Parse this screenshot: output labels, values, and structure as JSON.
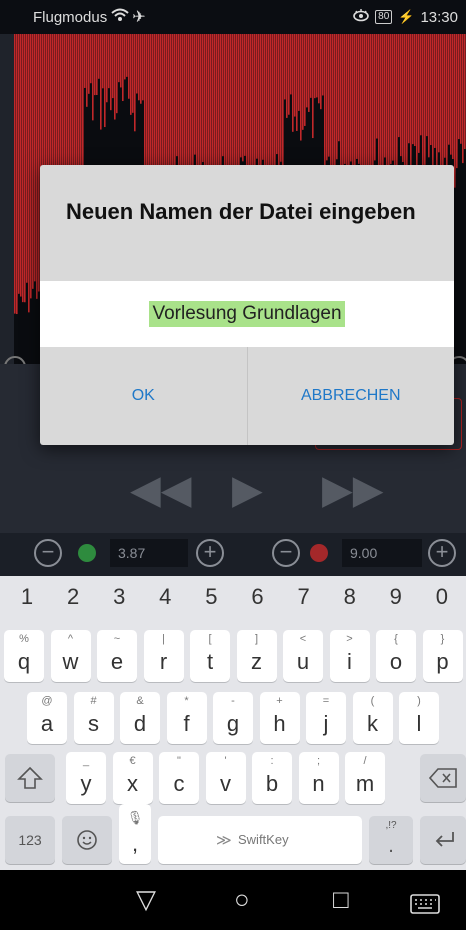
{
  "status_bar": {
    "left_text": "Flugmodus",
    "wifi_icon": "wifi-icon",
    "airplane_icon": "airplane-icon",
    "battery": "80",
    "time": "13:30"
  },
  "editor": {
    "start_value": "3.87",
    "end_value": "9.00",
    "waveform_color": "#c0282a"
  },
  "dialog": {
    "title": "Neuen Namen der Datei eingeben",
    "input_value": "Vorlesung Grundlagen",
    "ok_label": "OK",
    "cancel_label": "ABBRECHEN",
    "button_color": "#1f78c8",
    "selection_color": "#a9e28a"
  },
  "keyboard": {
    "number_row": [
      "1",
      "2",
      "3",
      "4",
      "5",
      "6",
      "7",
      "8",
      "9",
      "0"
    ],
    "row1": [
      {
        "main": "q",
        "sub": "%"
      },
      {
        "main": "w",
        "sub": "^"
      },
      {
        "main": "e",
        "sub": "~"
      },
      {
        "main": "r",
        "sub": "|"
      },
      {
        "main": "t",
        "sub": "["
      },
      {
        "main": "z",
        "sub": "]"
      },
      {
        "main": "u",
        "sub": "<"
      },
      {
        "main": "i",
        "sub": ">"
      },
      {
        "main": "o",
        "sub": "{"
      },
      {
        "main": "p",
        "sub": "}"
      }
    ],
    "row2": [
      {
        "main": "a",
        "sub": "@"
      },
      {
        "main": "s",
        "sub": "#"
      },
      {
        "main": "d",
        "sub": "&"
      },
      {
        "main": "f",
        "sub": "*"
      },
      {
        "main": "g",
        "sub": "-"
      },
      {
        "main": "h",
        "sub": "+"
      },
      {
        "main": "j",
        "sub": "="
      },
      {
        "main": "k",
        "sub": "("
      },
      {
        "main": "l",
        "sub": ")"
      }
    ],
    "row3": [
      {
        "main": "y",
        "sub": "_"
      },
      {
        "main": "x",
        "sub": "€"
      },
      {
        "main": "c",
        "sub": "\""
      },
      {
        "main": "v",
        "sub": "'"
      },
      {
        "main": "b",
        "sub": ":"
      },
      {
        "main": "n",
        "sub": ";"
      },
      {
        "main": "m",
        "sub": "/"
      }
    ],
    "shift_icon": "shift-icon",
    "backspace_icon": "backspace-icon",
    "mode_label": "123",
    "emoji_icon": "emoji-icon",
    "comma": ",",
    "mic_icon": "mic-icon",
    "space_label": "SwiftKey",
    "period": ".",
    "period_sub": ",!?",
    "enter_icon": "enter-icon"
  },
  "navbar": {
    "back_icon": "back-icon",
    "home_icon": "home-icon",
    "recents_icon": "recents-icon",
    "keyboard_icon": "keyboard-icon"
  }
}
